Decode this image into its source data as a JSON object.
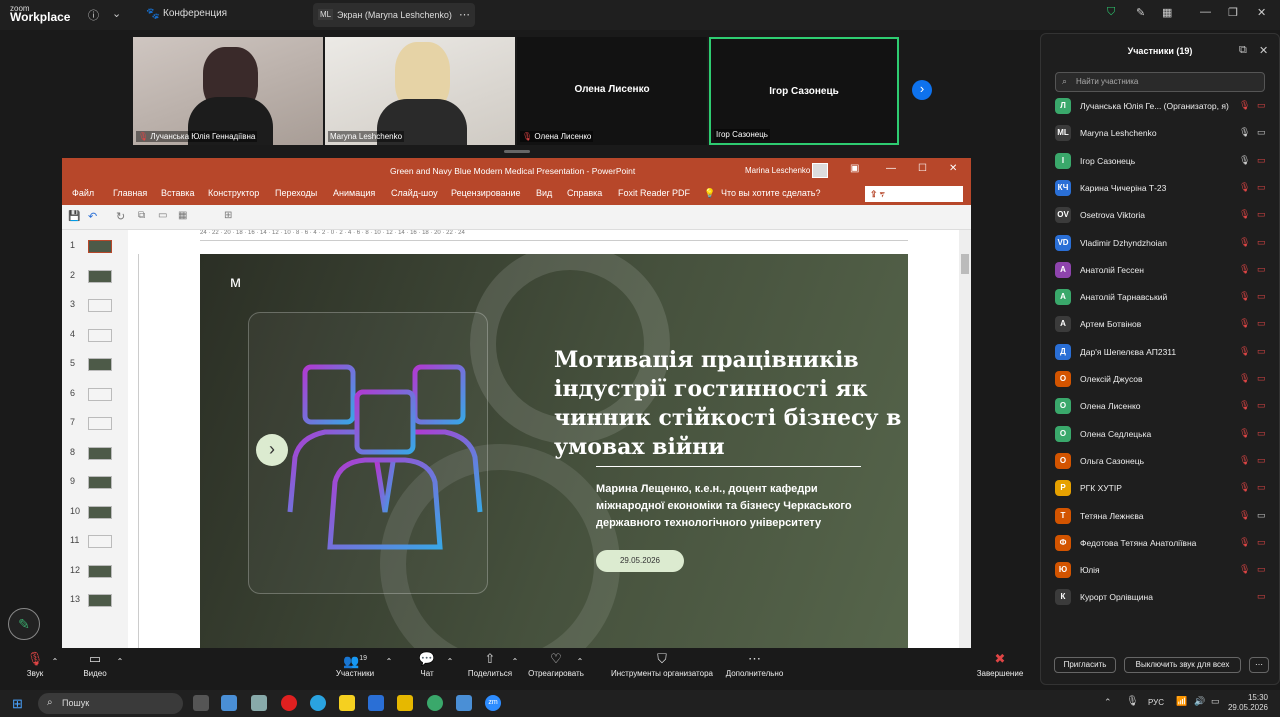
{
  "topbar": {
    "brand_small": "zoom",
    "brand": "Workplace",
    "conference": "Конференция",
    "screen_badge": "ML",
    "screen_tab": "Экран (Maryna Leshchenko)"
  },
  "videos": [
    {
      "name": "Лучанська Юлія Геннадіївна"
    },
    {
      "name": "Maryna Leshchenko"
    },
    {
      "center": "Олена Лисенко",
      "name": "Олена Лисенко"
    },
    {
      "center": "Ігор Сазонець",
      "name": "Ігор Сазонець"
    }
  ],
  "ppt": {
    "title": "Green and Navy Blue Modern Medical Presentation - PowerPoint",
    "user": "Marina Leschenko",
    "share": "Общий доступ",
    "menu": [
      "Файл",
      "Главная",
      "Вставка",
      "Конструктор",
      "Переходы",
      "Анимация",
      "Слайд-шоу",
      "Рецензирование",
      "Вид",
      "Справка",
      "Foxit Reader PDF",
      "Что вы хотите сделать?"
    ],
    "thumb_numbers": [
      "1",
      "2",
      "3",
      "4",
      "5",
      "6",
      "7",
      "8",
      "9",
      "10",
      "11",
      "12",
      "13"
    ],
    "ruler": "24 · 22 · 20 · 18 · 16 · 14 · 12 · 10 · 8 · 6 · 4 · 2 · 0 · 2 · 4 · 6 · 8 · 10 · 12 · 14 · 16 · 18 · 20 · 22 · 24"
  },
  "slide": {
    "title": "Мотивація працівників індустрії гостинності як чинник стійкості бізнесу в умовах війни",
    "subtitle": "Марина Лещенко, к.е.н., доцент кафедри міжнародної економіки та бізнесу Черкаського державного технологічного університету",
    "date": "29.05.2026"
  },
  "participants": {
    "title": "Участники (19)",
    "search_placeholder": "Найти участника",
    "invite": "Пригласить",
    "mute_all": "Выключить звук для всех",
    "list": [
      {
        "initials": "Л",
        "color": "#3aa86b",
        "name": "Лучанська Юлія Ге...  (Организатор, я)"
      },
      {
        "initials": "ML",
        "color": "#3b3b3b",
        "name": "Maryna Leshchenko"
      },
      {
        "initials": "І",
        "color": "#3aa86b",
        "name": "Ігор Сазонець"
      },
      {
        "initials": "КЧ",
        "color": "#2a6fd6",
        "name": "Карина Чичеріна Т-23"
      },
      {
        "initials": "OV",
        "color": "#3b3b3b",
        "name": "Osetrova Viktoria"
      },
      {
        "initials": "VD",
        "color": "#2a6fd6",
        "name": "Vladimir Dzhyndzhoian"
      },
      {
        "initials": "А",
        "color": "#8e44ad",
        "name": "Анатолій Гессен"
      },
      {
        "initials": "А",
        "color": "#3aa86b",
        "name": "Анатолій Тарнавський"
      },
      {
        "initials": "А",
        "color": "#3b3b3b",
        "name": "Артем Ботвінов"
      },
      {
        "initials": "Д",
        "color": "#2a6fd6",
        "name": "Дар'я Шепелєва АП2311"
      },
      {
        "initials": "О",
        "color": "#d35400",
        "name": "Олексій Джусов"
      },
      {
        "initials": "О",
        "color": "#3aa86b",
        "name": "Олена Лисенко"
      },
      {
        "initials": "О",
        "color": "#3aa86b",
        "name": "Олена Седлецька"
      },
      {
        "initials": "О",
        "color": "#d35400",
        "name": "Ольга Сазонець"
      },
      {
        "initials": "Р",
        "color": "#e6a100",
        "name": "РГК ХУТІР"
      },
      {
        "initials": "Т",
        "color": "#d35400",
        "name": "Тетяна Лежнєва"
      },
      {
        "initials": "Ф",
        "color": "#d35400",
        "name": "Федотова Тетяна Анатоліївна"
      },
      {
        "initials": "Ю",
        "color": "#d35400",
        "name": "Юлія"
      },
      {
        "initials": "К",
        "color": "#3b3b3b",
        "name": "Курорт Орлівщина"
      }
    ]
  },
  "toolbar": {
    "audio": "Звук",
    "video": "Видео",
    "participants": "Участники",
    "participants_count": "19",
    "chat": "Чат",
    "share": "Поделиться",
    "react": "Отреагировать",
    "host_tools": "Инструменты организатора",
    "more": "Дополнительно",
    "end": "Завершение"
  },
  "taskbar": {
    "search": "Пошук",
    "lang": "РУС",
    "time": "15:30",
    "date": "29.05.2026"
  }
}
